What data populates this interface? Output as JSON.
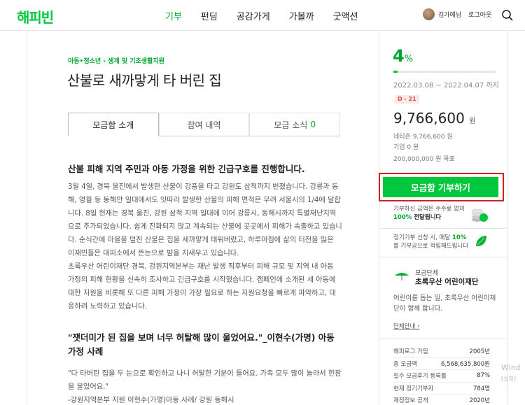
{
  "header": {
    "logo": "해피빈",
    "nav": [
      "기부",
      "펀딩",
      "공감가게",
      "가볼까",
      "굿액션"
    ],
    "user_name": "김가예님",
    "logout": "로그아웃",
    "search_icon": "search-icon"
  },
  "main": {
    "breadcrumb": "아동•청소년 › 생계 및 기초생활지원",
    "title": "산불로 새까맣게 타 버린 집",
    "tabs": [
      {
        "label": "모금함 소개",
        "count": ""
      },
      {
        "label": "참여 내역",
        "count": ""
      },
      {
        "label": "모금 소식",
        "count": "0"
      }
    ],
    "lead": "산불 피해 지역 주민과 아동 가정을 위한 긴급구호를 진행합니다.",
    "paragraphs": [
      "3월 4일, 경북 울진에서 발생한 산불이 강풍을 타고 강원도 삼척까지 번졌습니다. 강릉과 동해, 영월 등 동해안 일대에서도 잇따라 발생한 산불의 피해 면적은 무려 서울시의 1/4에 달합니다. 8일 현재는 경북 울진, 강원 삼척 지역 일대에 이어 강릉시, 동해시까지 특별재난지역으로 추가되었습니다. 쉽게 진화되지 않고 계속되는 산불에 곳곳에서 피해가 속출하고 있습니다. 순식간에 마을을 덮친 산불은 집을 새까맣게 태워버렸고, 하루아침에 삶의 터전을 잃은 이재민들은 대피소에서 뜬눈으로 밤을 지새우고 있습니다.",
      "초록우산 어린이재단 경북, 강원지역본부는 재난 발생 직후부터 피해 규모 및 지역 내 아동 가정의 피해 현황을 신속히 조사하고 긴급구호를 시작했습니다. 캠페인에 소개된 세 아동에 대한 지원을 비롯해 또 다른 피해 가정이 가장 필요로 하는 지원요청을 빠르게 파악하고, 대응하려 노력하고 있습니다."
    ],
    "subhead": "\"잿더미가 된 집을 보며 너무 허탈해 많이 울었어요.\"_이현수(가명) 아동 가정 사례",
    "quote_lines": [
      "\"다 타버린 집을 두 눈으로 확인하고 나니 허탈한 기분이 들어요. 가족 모두 많이 놀라서 한참을 울었어요.\"",
      "-강원지역본부 지원 이현수(가명)아동 사례/ 강원 동해시"
    ]
  },
  "sidebar": {
    "percent": "4",
    "percent_unit": "%",
    "progress_ratio": 0.04,
    "dates": "2022.03.08 ~ 2022.04.07 까지",
    "dday": "D - 21",
    "amount": "9,766,600",
    "amount_unit": "원",
    "netizen": "네티즌 9,766,600 원",
    "company": "기업 0 원",
    "goal": "200,000,000 원 목표",
    "donate_button": "모금함 기부하기",
    "notice1_a": "기부하신 금액은 수수료 없이",
    "notice1_b": "100%",
    "notice1_c": "전달됩니다",
    "notice2_a": "정기기부 신청 시, 매달",
    "notice2_b": "10%",
    "notice2_c": "를 기부공으로 적립해드립니다",
    "org_label": "모금단체",
    "org_name": "초록우산 어린이재단",
    "org_desc": "어린이를 돕는 일, 초록우산 어린이재단이 함께 합니다.",
    "org_link": "단체안내 ›",
    "stats": [
      {
        "label": "해피로그 가입",
        "value": "2005년"
      },
      {
        "label": "총 모금액",
        "value": "6,568,635,800원"
      },
      {
        "label": "필수 모금후기 등록률",
        "value": "87%"
      },
      {
        "label": "현재 정기기부자",
        "value": "784명"
      },
      {
        "label": "재정정보 공개",
        "value": "2020년"
      }
    ],
    "accent": "#00c73c"
  },
  "os_watermark": {
    "line1": "Wind",
    "line2": "[설정]"
  }
}
